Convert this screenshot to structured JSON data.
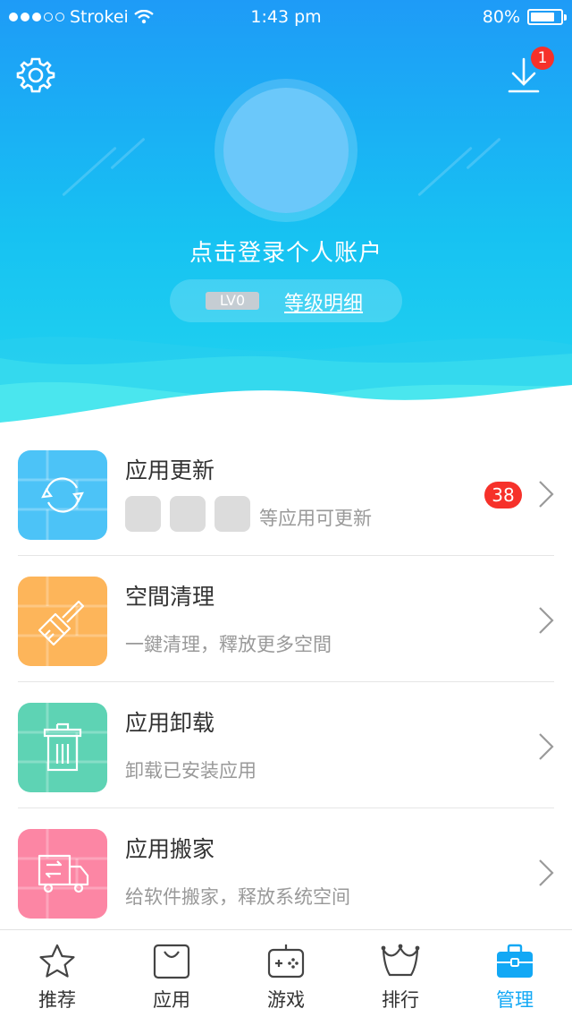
{
  "status_bar": {
    "carrier": "Strokei",
    "time": "1:43 pm",
    "battery": "80%",
    "battery_level": 0.8
  },
  "header": {
    "login_prompt": "点击登录个人账户",
    "level_badge": "LV0",
    "level_link": "等级明细",
    "download_badge": "1",
    "settings_icon": "gear-icon",
    "download_icon": "download-icon"
  },
  "list": {
    "items": [
      {
        "title": "应用更新",
        "subtitle": "等应用可更新",
        "badge": "38",
        "icon": "refresh-icon",
        "color": "#4CC3F7"
      },
      {
        "title": "空間清理",
        "subtitle": "一鍵清理，釋放更多空間",
        "icon": "broom-icon",
        "color": "#FDB55A"
      },
      {
        "title": "应用卸载",
        "subtitle": "卸载已安装应用",
        "icon": "trash-icon",
        "color": "#5ED3B4"
      },
      {
        "title": "应用搬家",
        "subtitle": "给软件搬家，释放系统空间",
        "icon": "moving-truck-icon",
        "color": "#FC86A4"
      }
    ]
  },
  "tabbar": {
    "tabs": [
      {
        "label": "推荐",
        "icon": "star-icon",
        "active": false
      },
      {
        "label": "应用",
        "icon": "bag-icon",
        "active": false
      },
      {
        "label": "游戏",
        "icon": "gamepad-icon",
        "active": false
      },
      {
        "label": "排行",
        "icon": "crown-icon",
        "active": false
      },
      {
        "label": "管理",
        "icon": "toolbox-icon",
        "active": true
      }
    ],
    "active_color": "#12A8F5"
  }
}
